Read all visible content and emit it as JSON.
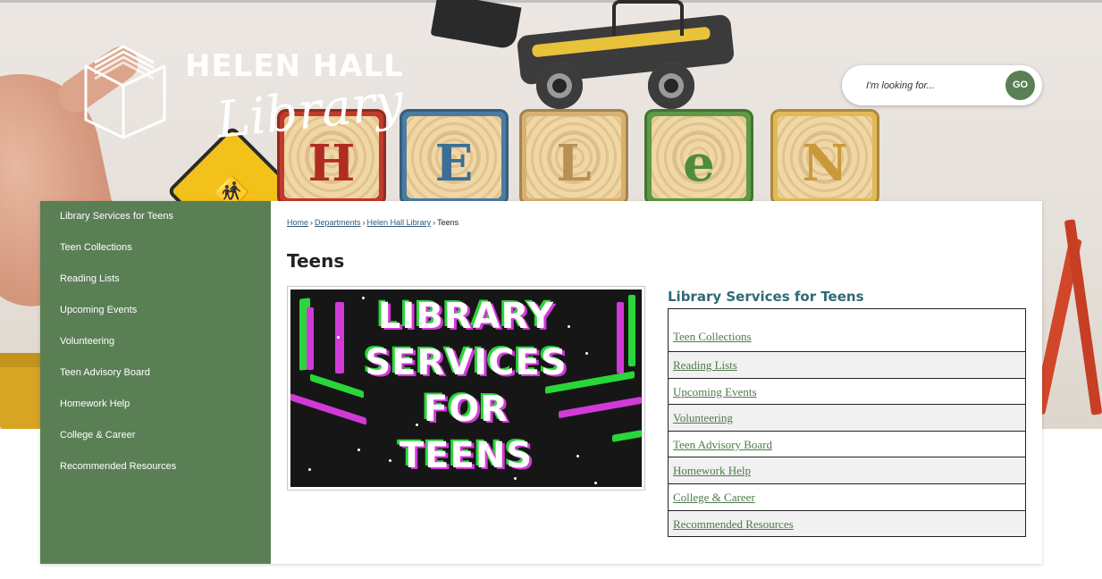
{
  "header": {
    "logo": {
      "line1": "HELEN HALL",
      "line2": "Library"
    },
    "block_letters": [
      "H",
      "E",
      "L",
      "e",
      "N"
    ],
    "search": {
      "placeholder": "I'm looking for...",
      "button_label": "GO"
    }
  },
  "sidebar": {
    "items": [
      {
        "label": "Library Services for Teens"
      },
      {
        "label": "Teen Collections"
      },
      {
        "label": "Reading Lists"
      },
      {
        "label": "Upcoming Events"
      },
      {
        "label": "Volunteering"
      },
      {
        "label": "Teen Advisory Board"
      },
      {
        "label": "Homework Help"
      },
      {
        "label": "College & Career"
      },
      {
        "label": "Recommended Resources"
      }
    ]
  },
  "breadcrumb": {
    "home": "Home",
    "departments": "Departments",
    "library": "Helen Hall Library",
    "current": "Teens",
    "separator": "›"
  },
  "page": {
    "title": "Teens",
    "feature_image_text": [
      "LIBRARY",
      "SERVICES",
      "FOR",
      "TEENS"
    ]
  },
  "services": {
    "heading": "Library Services for Teens",
    "links": [
      "Teen Collections",
      "Reading Lists",
      "Upcoming Events",
      "Volunteering",
      "Teen Advisory Board",
      "Homework Help",
      "College & Career",
      "Recommended Resources"
    ]
  },
  "colors": {
    "sidebar_green": "#5a7f55",
    "heading_teal": "#2f6a78",
    "link_green": "#4f7a4b",
    "breadcrumb_link": "#2f5b7a"
  }
}
